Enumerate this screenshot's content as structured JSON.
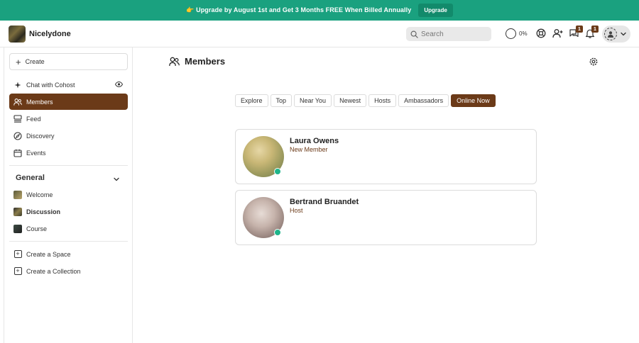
{
  "banner": {
    "text": "👉 Upgrade by August 1st and Get 3 Months FREE When Billed Annually",
    "button_label": "Upgrade"
  },
  "header": {
    "community_name": "Nicelydone",
    "search_placeholder": "Search",
    "progress_text": "0%",
    "invite_badge": "1",
    "messages_badge": "1"
  },
  "sidebar": {
    "create_label": "Create",
    "nav": [
      {
        "label": "Chat with Cohost",
        "icon": "sparkle-icon"
      },
      {
        "label": "Members",
        "icon": "members-icon"
      },
      {
        "label": "Feed",
        "icon": "feed-icon"
      },
      {
        "label": "Discovery",
        "icon": "compass-icon"
      },
      {
        "label": "Events",
        "icon": "calendar-icon"
      }
    ],
    "section_title": "General",
    "spaces": [
      {
        "label": "Welcome"
      },
      {
        "label": "Discussion"
      },
      {
        "label": "Course"
      }
    ],
    "actions": [
      {
        "label": "Create a Space"
      },
      {
        "label": "Create a Collection"
      }
    ]
  },
  "main": {
    "title": "Members",
    "tabs": [
      "Explore",
      "Top",
      "Near You",
      "Newest",
      "Hosts",
      "Ambassadors",
      "Online Now"
    ],
    "active_tab": "Online Now",
    "members": [
      {
        "name": "Laura Owens",
        "role": "New Member",
        "online": true
      },
      {
        "name": "Bertrand Bruandet",
        "role": "Host",
        "online": true
      }
    ]
  },
  "colors": {
    "banner": "#1aa17f",
    "accent": "#6b3a18",
    "online": "#1fb58b"
  }
}
